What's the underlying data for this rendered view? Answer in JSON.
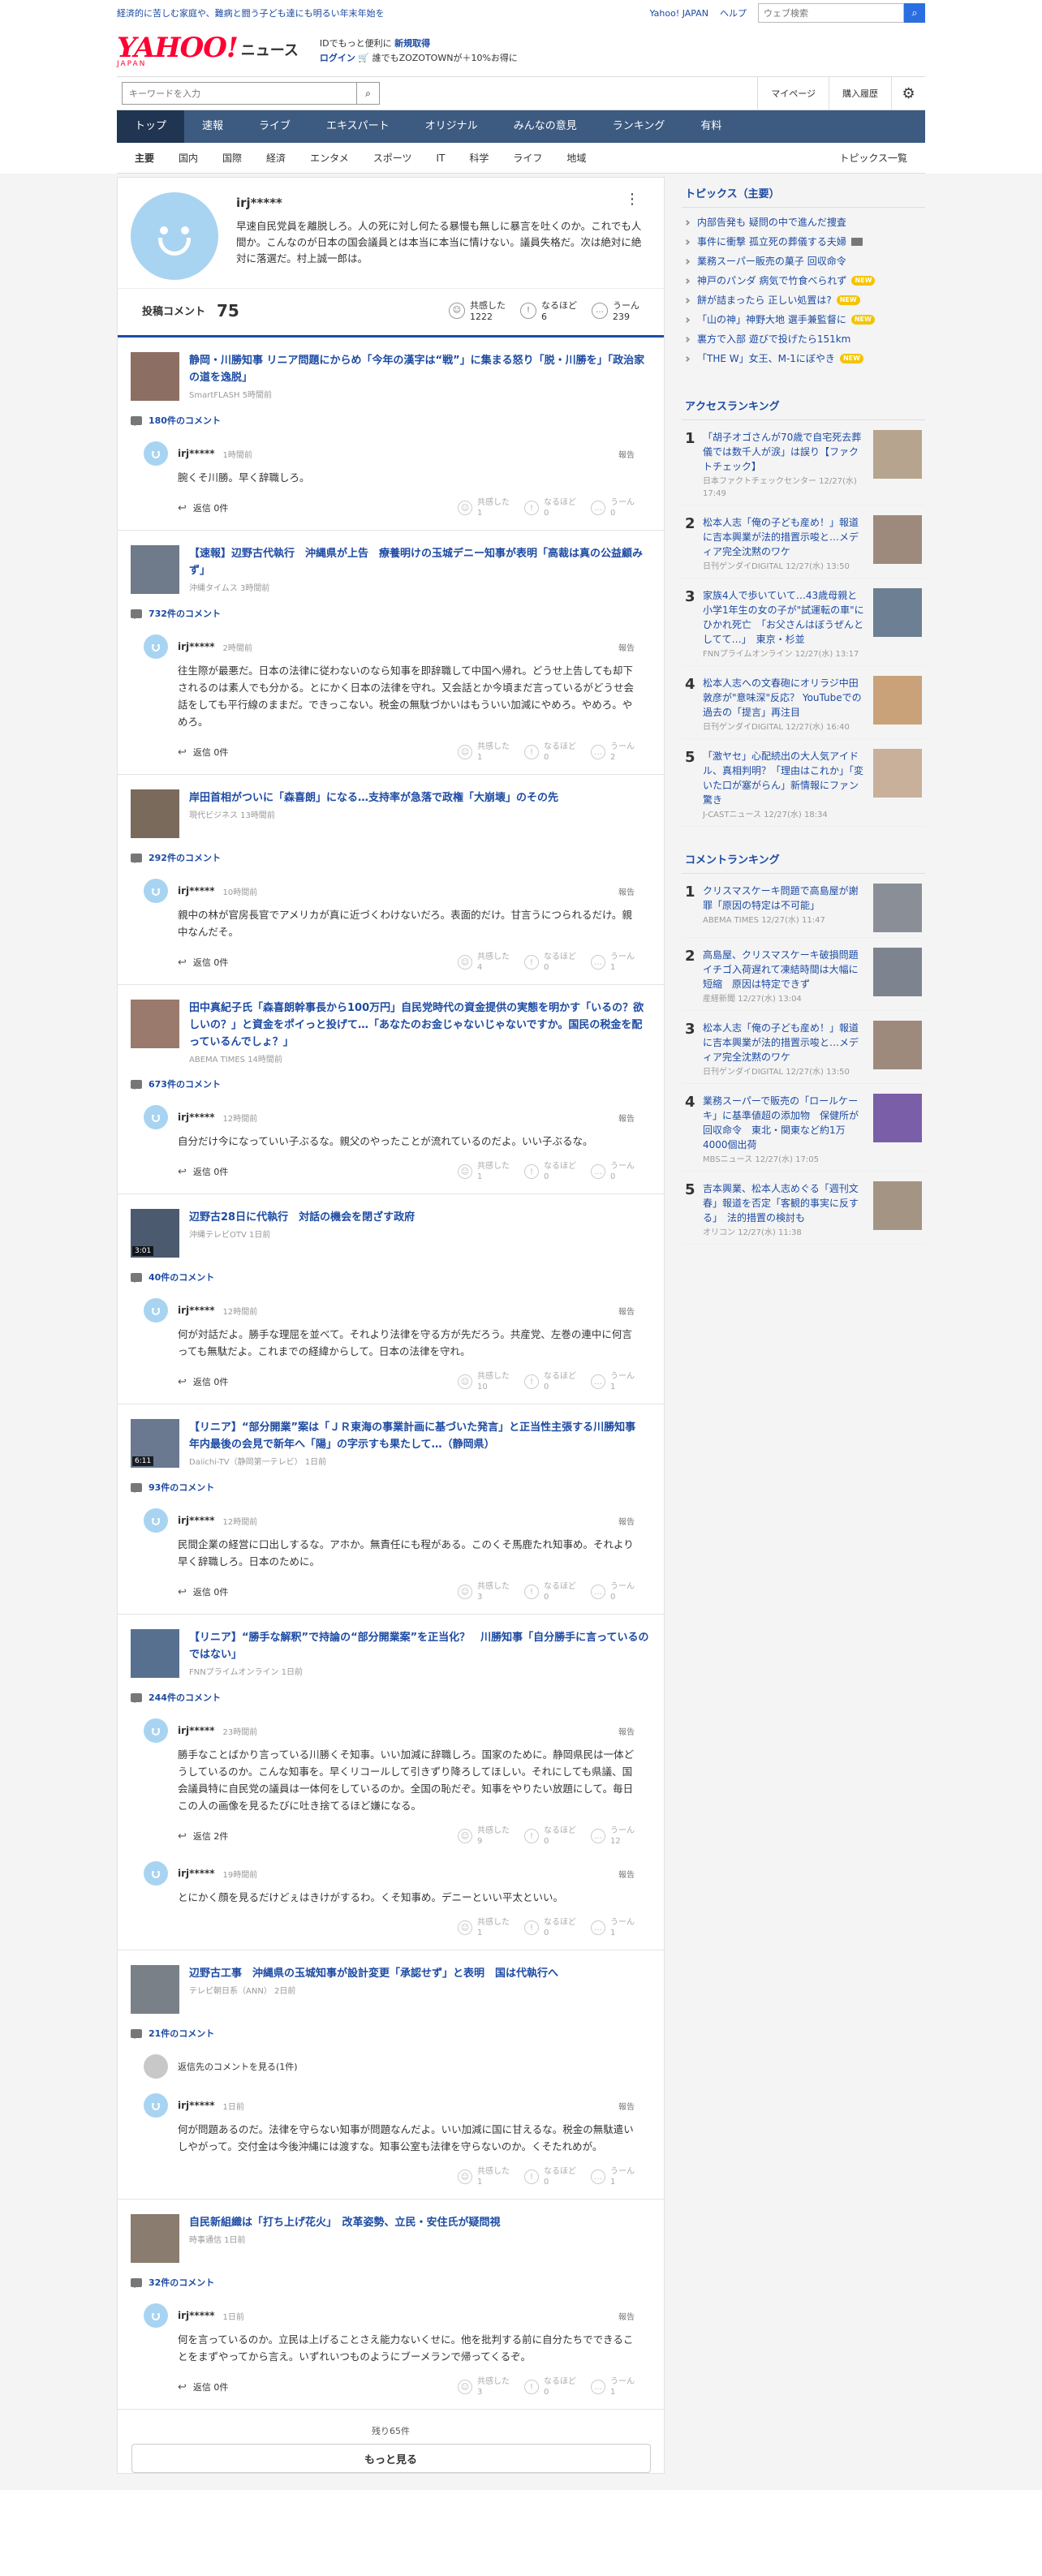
{
  "topbar": {
    "message": "経済的に苦しむ家庭や、難病と闘う子ども達にも明るい年末年始を",
    "yahoo_link": "Yahoo! JAPAN",
    "help_link": "ヘルプ",
    "search_placeholder": "ウェブ検索"
  },
  "header": {
    "logo_main": "YAHOO!",
    "logo_sub": "JAPAN",
    "logo_news": "ニュース",
    "id_line": "IDでもっと便利に",
    "new_signup": "新規取得",
    "login": "ログイン",
    "zozo": "誰でもZOZOTOWNが＋10%お得に"
  },
  "searchbar": {
    "placeholder": "キーワードを入力",
    "mypage": "マイページ",
    "purchases": "購入履歴"
  },
  "categories": [
    "トップ",
    "速報",
    "ライブ",
    "エキスパート",
    "オリジナル",
    "みんなの意見",
    "ランキング",
    "有料"
  ],
  "subcategories": [
    "主要",
    "国内",
    "国際",
    "経済",
    "エンタメ",
    "スポーツ",
    "IT",
    "科学",
    "ライフ",
    "地域"
  ],
  "topics_list_link": "トピックス一覧",
  "profile": {
    "name": "irj*****",
    "bio": "早速自民党員を離脱しろ。人の死に対し何たる暴慢も無しに暴言を吐くのか。これでも人間か。こんなのが日本の国会議員とは本当に本当に情けない。議員失格だ。次は絶対に絶対に落選だ。村上誠一郎は。",
    "posts_label": "投稿コメント",
    "posts_count": "75",
    "agree_label": "共感した",
    "agree_count": "1222",
    "naruhodo_label": "なるほど",
    "naruhodo_count": "6",
    "uun_label": "うーん",
    "uun_count": "239"
  },
  "labels": {
    "reply": "返信",
    "report": "報告",
    "agree": "共感した",
    "naruhodo": "なるほど",
    "uun": "うーん"
  },
  "entries": [
    {
      "title": "静岡・川勝知事 リニア問題にからめ「今年の漢字は“戦”」に集まる怒り「脱・川勝を」「政治家の道を逸脱」",
      "meta": "SmartFLASH 5時間前",
      "comment_count": "180件のコメント",
      "comments": [
        {
          "user": "irj*****",
          "time": "1時間前",
          "body": "腕くそ川勝。早く辞職しろ。",
          "replies": "返信 0件",
          "agree": "1",
          "naru": "0",
          "uun": "0"
        }
      ]
    },
    {
      "title": "【速報】辺野古代執行　沖縄県が上告　療養明けの玉城デニー知事が表明「高裁は真の公益顧みず」",
      "meta": "沖縄タイムス 3時間前",
      "comment_count": "732件のコメント",
      "comments": [
        {
          "user": "irj*****",
          "time": "2時間前",
          "body": "往生際が最悪だ。日本の法律に従わないのなら知事を即辞職して中国へ帰れ。どうせ上告しても却下されるのは素人でも分かる。とにかく日本の法律を守れ。又会話とか今頃まだ言っているがどうせ会話をしても平行線のままだ。できっこない。税金の無駄づかいはもういい加減にやめろ。やめろ。やめろ。",
          "replies": "返信 0件",
          "agree": "1",
          "naru": "0",
          "uun": "2"
        }
      ]
    },
    {
      "title": "岸田首相がついに「森喜朗」になる…支持率が急落で政権「大崩壊」のその先",
      "meta": "現代ビジネス 13時間前",
      "comment_count": "292件のコメント",
      "comments": [
        {
          "user": "irj*****",
          "time": "10時間前",
          "body": "親中の林が官房長官でアメリカが真に近づくわけないだろ。表面的だけ。甘言うにつられるだけ。親中なんだそ。",
          "replies": "返信 0件",
          "agree": "4",
          "naru": "0",
          "uun": "1"
        }
      ]
    },
    {
      "title": "田中真紀子氏「森喜朗幹事長から100万円」自民党時代の資金提供の実態を明かす「いるの？欲しいの？」と資金をポイっと投げて…「あなたのお金じゃないじゃないですか。国民の税金を配っているんでしょ？」",
      "meta": "ABEMA TIMES 14時間前",
      "comment_count": "673件のコメント",
      "comments": [
        {
          "user": "irj*****",
          "time": "12時間前",
          "body": "自分だけ今になっていい子ぶるな。親父のやったことが流れているのだよ。いい子ぶるな。",
          "replies": "返信 0件",
          "agree": "1",
          "naru": "0",
          "uun": "0"
        }
      ]
    },
    {
      "title": "辺野古28日に代執行　対話の機会を閉ざす政府",
      "meta": "沖縄テレビOTV 1日前",
      "duration": "3:01",
      "comment_count": "40件のコメント",
      "comments": [
        {
          "user": "irj*****",
          "time": "12時間前",
          "body": "何が対話だよ。勝手な理屈を並べて。それより法律を守る方が先だろう。共産党、左巻の連中に何言っても無駄だよ。これまでの経緯からして。日本の法律を守れ。",
          "replies": "返信 0件",
          "agree": "10",
          "naru": "0",
          "uun": "1"
        }
      ]
    },
    {
      "title": "【リニア】“部分開業”案は「ＪＲ東海の事業計画に基づいた発言」と正当性主張する川勝知事　年内最後の会見で新年へ「陽」の字示すも果たして…（静岡県）",
      "meta": "Daiichi-TV（静岡第一テレビ） 1日前",
      "duration": "6:11",
      "comment_count": "93件のコメント",
      "comments": [
        {
          "user": "irj*****",
          "time": "12時間前",
          "body": "民間企業の経営に口出しするな。アホか。無責任にも程がある。このくそ馬鹿たれ知事め。それより早く辞職しろ。日本のために。",
          "replies": "返信 0件",
          "agree": "3",
          "naru": "0",
          "uun": "0"
        }
      ]
    },
    {
      "title": "【リニア】“勝手な解釈”で持論の“部分開業案”を正当化？　川勝知事「自分勝手に言っているのではない」",
      "meta": "FNNプライムオンライン 1日前",
      "comment_count": "244件のコメント",
      "comments": [
        {
          "user": "irj*****",
          "time": "23時間前",
          "body": "勝手なことばかり言っている川勝くそ知事。いい加減に辞職しろ。国家のために。静岡県民は一体どうしているのか。こんな知事を。早くリコールして引きずり降ろしてほしい。それにしても県議、国会議員特に自民党の議員は一体何をしているのか。全国の恥だぞ。知事をやりたい放題にして。毎日この人の画像を見るたびに吐き捨てるほど嫌になる。",
          "replies": "返信 2件",
          "agree": "9",
          "naru": "0",
          "uun": "12"
        },
        {
          "user": "irj*****",
          "time": "19時間前",
          "body": "とにかく顔を見るだけどぇはきけがするわ。くそ知事め。デニーといい平太といい。",
          "replies": "",
          "agree": "1",
          "naru": "0",
          "uun": "1"
        }
      ]
    },
    {
      "title": "辺野古工事　沖縄県の玉城知事が設計変更「承認せず」と表明　国は代執行へ",
      "meta": "テレビ朝日系（ANN） 2日前",
      "comment_count": "21件のコメント",
      "parent_comment": "返信先のコメントを見る(1件)",
      "comments": [
        {
          "user": "irj*****",
          "time": "1日前",
          "body": "何が問題あるのだ。法律を守らない知事が問題なんだよ。いい加減に国に甘えるな。税金の無駄遣いしやがって。交付金は今後沖縄には渡すな。知事公室も法律を守らないのか。くそたれめが。",
          "replies": "",
          "agree": "1",
          "naru": "0",
          "uun": "1"
        }
      ]
    },
    {
      "title": "自民新組織は「打ち上げ花火」　改革姿勢、立民・安住氏が疑問視",
      "meta": "時事通信 1日前",
      "comment_count": "32件のコメント",
      "comments": [
        {
          "user": "irj*****",
          "time": "1日前",
          "body": "何を言っているのか。立民は上げることさえ能力ないくせに。他を批判する前に自分たちでできることをまずやってから言え。いずれいつものようにブーメランで帰ってくるぞ。",
          "replies": "返信 0件",
          "agree": "3",
          "naru": "0",
          "uun": "1"
        }
      ]
    }
  ],
  "remaining": "残り65件",
  "more_button": "もっと見る",
  "sidebar": {
    "topics_heading": "トピックス（主要）",
    "topics": [
      {
        "text": "内部告発も 疑問の中で進んだ捜査",
        "badge": ""
      },
      {
        "text": "事件に衝撃 孤立死の葬儀する夫婦",
        "badge": "img"
      },
      {
        "text": "業務スーパー販売の菓子 回収命令",
        "badge": ""
      },
      {
        "text": "神戸のパンダ 病気で竹食べられず",
        "badge": "NEW"
      },
      {
        "text": "餅が詰まったら 正しい処置は?",
        "badge": "NEW"
      },
      {
        "text": "「山の神」神野大地 選手兼監督に",
        "badge": "NEW"
      },
      {
        "text": "裏方で入部 遊びで投げたら151km",
        "badge": ""
      },
      {
        "text": "「THE W」女王、M-1にぼやき",
        "badge": "NEW"
      }
    ],
    "access_heading": "アクセスランキング",
    "access": [
      {
        "num": "1",
        "title": "「胡子オゴさんが70歳で自宅死去葬儀では数千人が涙」は誤り【ファクトチェック】",
        "src": "日本ファクトチェックセンター 12/27(水) 17:49"
      },
      {
        "num": "2",
        "title": "松本人志「俺の子ども産め！」報道に吉本興業が法的措置示唆と…メディア完全沈黙のワケ",
        "src": "日刊ゲンダイDIGITAL 12/27(水) 13:50"
      },
      {
        "num": "3",
        "title": "家族4人で歩いていて…43歳母親と小学1年生の女の子が\"試運転の車\"にひかれ死亡　「お父さんはぼうぜんとしてて…」　東京・杉並",
        "src": "FNNプライムオンライン 12/27(水) 13:17"
      },
      {
        "num": "4",
        "title": "松本人志への文春砲にオリラジ中田敦彦が\"意味深\"反応？ YouTubeでの過去の「提言」再注目",
        "src": "日刊ゲンダイDIGITAL 12/27(水) 16:40"
      },
      {
        "num": "5",
        "title": "「激ヤセ」心配続出の大人気アイドル、真相判明？「理由はこれか」「変いた口が塞がらん」新情報にファン驚き",
        "src": "J-CASTニュース 12/27(水) 18:34"
      }
    ],
    "comment_heading": "コメントランキング",
    "comment_rank": [
      {
        "num": "1",
        "title": "クリスマスケーキ問題で高島屋が謝罪「原因の特定は不可能」",
        "src": "ABEMA TIMES 12/27(水) 11:47"
      },
      {
        "num": "2",
        "title": "高島屋、クリスマスケーキ破損問題　イチゴ入荷遅れて凍結時間は大幅に短縮　原因は特定できず",
        "src": "産経新聞 12/27(水) 13:04"
      },
      {
        "num": "3",
        "title": "松本人志「俺の子ども産め！」報道に吉本興業が法的措置示唆と…メディア完全沈黙のワケ",
        "src": "日刊ゲンダイDIGITAL 12/27(水) 13:50"
      },
      {
        "num": "4",
        "title": "業務スーパーで販売の「ロールケーキ」に基準値超の添加物　保健所が回収命令　東北・関東など約1万4000個出荷",
        "src": "MBSニュース 12/27(水) 17:05"
      },
      {
        "num": "5",
        "title": "吉本興業、松本人志めぐる「週刊文春」報道を否定「客観的事実に反する」　法的措置の検討も",
        "src": "オリコン 12/27(水) 11:38"
      }
    ]
  },
  "colors": {
    "brand": "#ff0033",
    "link": "#1d4ba3",
    "nav": "#3d5a80",
    "nav_active": "#1f3552",
    "avatar": "#a8d4f2",
    "new_badge": "#f5c400"
  }
}
